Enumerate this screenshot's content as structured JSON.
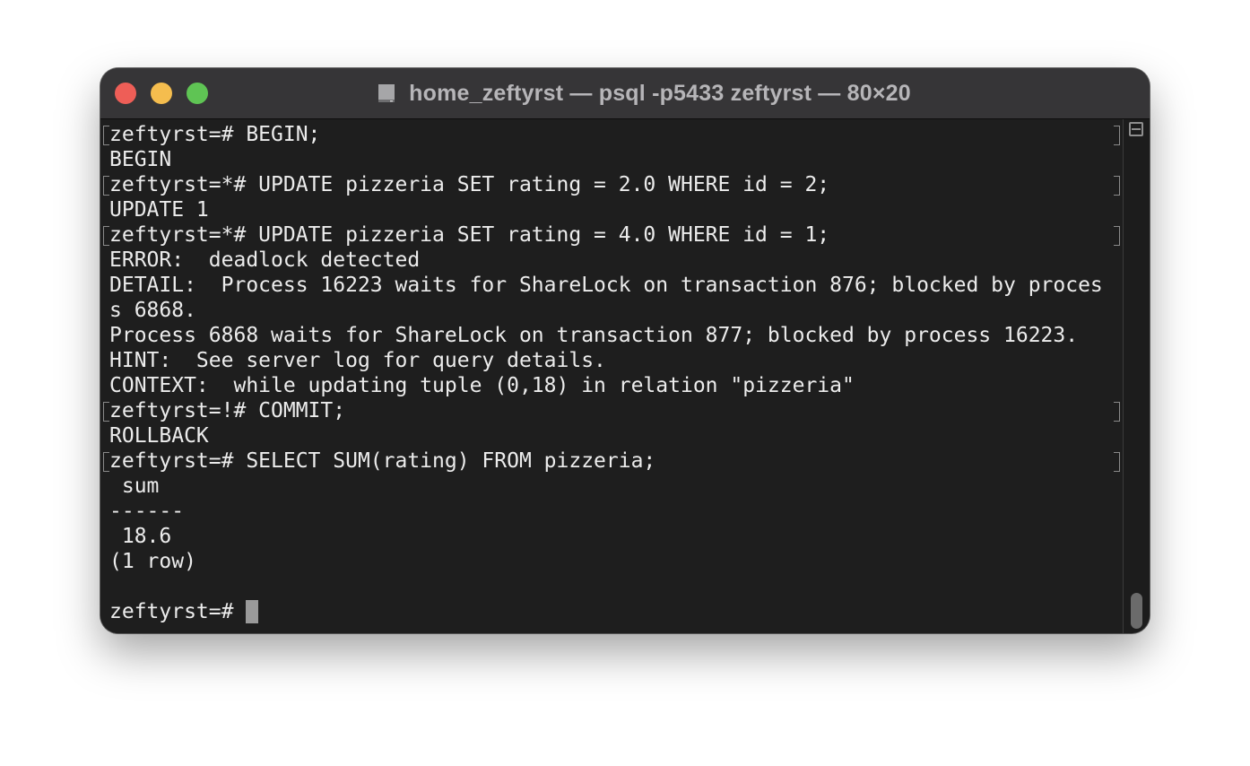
{
  "window": {
    "title": "home_zeftyrst — psql -p5433 zeftyrst — 80×20"
  },
  "terminal": {
    "lines": [
      {
        "text": "zeftyrst=# BEGIN;",
        "marked": true
      },
      {
        "text": "BEGIN",
        "marked": false
      },
      {
        "text": "zeftyrst=*# UPDATE pizzeria SET rating = 2.0 WHERE id = 2;",
        "marked": true
      },
      {
        "text": "UPDATE 1",
        "marked": false
      },
      {
        "text": "zeftyrst=*# UPDATE pizzeria SET rating = 4.0 WHERE id = 1;",
        "marked": true
      },
      {
        "text": "ERROR:  deadlock detected",
        "marked": false
      },
      {
        "text": "DETAIL:  Process 16223 waits for ShareLock on transaction 876; blocked by proces",
        "marked": false
      },
      {
        "text": "s 6868.",
        "marked": false
      },
      {
        "text": "Process 6868 waits for ShareLock on transaction 877; blocked by process 16223.",
        "marked": false
      },
      {
        "text": "HINT:  See server log for query details.",
        "marked": false
      },
      {
        "text": "CONTEXT:  while updating tuple (0,18) in relation \"pizzeria\"",
        "marked": false
      },
      {
        "text": "zeftyrst=!# COMMIT;",
        "marked": true
      },
      {
        "text": "ROLLBACK",
        "marked": false
      },
      {
        "text": "zeftyrst=# SELECT SUM(rating) FROM pizzeria;",
        "marked": true
      },
      {
        "text": " sum",
        "marked": false
      },
      {
        "text": "------",
        "marked": false
      },
      {
        "text": " 18.6",
        "marked": false
      },
      {
        "text": "(1 row)",
        "marked": false
      },
      {
        "text": "",
        "marked": false
      }
    ],
    "prompt": "zeftyrst=# "
  },
  "colors": {
    "close": "#ee5e57",
    "minimize": "#f5bd4e",
    "zoom": "#5fc454",
    "background": "#1e1e1e",
    "foreground": "#ececec"
  }
}
